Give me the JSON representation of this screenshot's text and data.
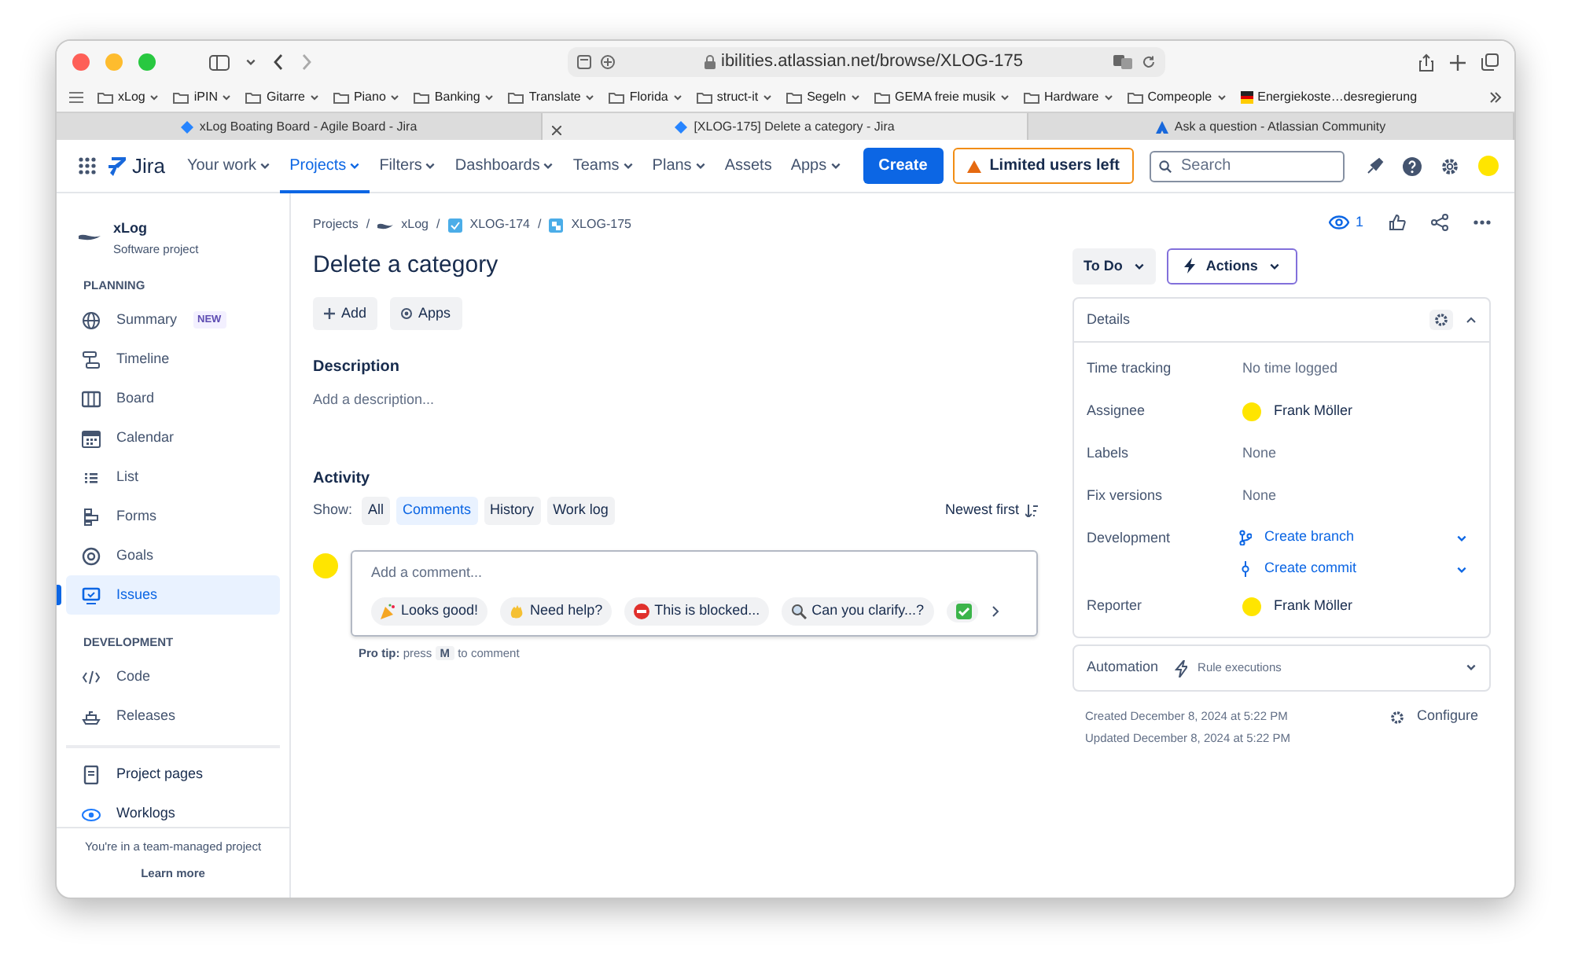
{
  "browser": {
    "url": "ibilities.atlassian.net/browse/XLOG-175",
    "bookmarks": [
      {
        "label": "xLog",
        "kind": "folder"
      },
      {
        "label": "iPIN",
        "kind": "folder"
      },
      {
        "label": "Gitarre",
        "kind": "folder"
      },
      {
        "label": "Piano",
        "kind": "folder"
      },
      {
        "label": "Banking",
        "kind": "folder"
      },
      {
        "label": "Translate",
        "kind": "folder"
      },
      {
        "label": "Florida",
        "kind": "folder"
      },
      {
        "label": "struct-it",
        "kind": "folder"
      },
      {
        "label": "Segeln",
        "kind": "folder"
      },
      {
        "label": "GEMA freie musik",
        "kind": "folder"
      },
      {
        "label": "Hardware",
        "kind": "folder"
      },
      {
        "label": "Compeople",
        "kind": "folder"
      },
      {
        "label": "Energiekoste…desregierung",
        "kind": "site"
      }
    ],
    "tabs": [
      {
        "title": "xLog Boating Board - Agile Board - Jira",
        "selected": false
      },
      {
        "title": "[XLOG-175] Delete a category - Jira",
        "selected": true
      },
      {
        "title": "Ask a question - Atlassian Community",
        "selected": false
      }
    ]
  },
  "topnav": {
    "product": "Jira",
    "menu": [
      {
        "label": "Your work",
        "dropdown": true,
        "selected": false
      },
      {
        "label": "Projects",
        "dropdown": true,
        "selected": true
      },
      {
        "label": "Filters",
        "dropdown": true,
        "selected": false
      },
      {
        "label": "Dashboards",
        "dropdown": true,
        "selected": false
      },
      {
        "label": "Teams",
        "dropdown": true,
        "selected": false
      },
      {
        "label": "Plans",
        "dropdown": true,
        "selected": false
      },
      {
        "label": "Assets",
        "dropdown": false,
        "selected": false
      },
      {
        "label": "Apps",
        "dropdown": true,
        "selected": false
      }
    ],
    "create": "Create",
    "warning": "Limited users left",
    "search": {
      "placeholder": "Search"
    }
  },
  "sidebar": {
    "project": {
      "name": "xLog",
      "type": "Software project"
    },
    "sections": [
      {
        "heading": "PLANNING",
        "items": [
          {
            "label": "Summary",
            "badge": "NEW",
            "selected": false
          },
          {
            "label": "Timeline",
            "selected": false
          },
          {
            "label": "Board",
            "selected": false
          },
          {
            "label": "Calendar",
            "selected": false
          },
          {
            "label": "List",
            "selected": false
          },
          {
            "label": "Forms",
            "selected": false
          },
          {
            "label": "Goals",
            "selected": false
          },
          {
            "label": "Issues",
            "selected": true
          }
        ]
      },
      {
        "heading": "DEVELOPMENT",
        "items": [
          {
            "label": "Code",
            "selected": false
          },
          {
            "label": "Releases",
            "selected": false
          }
        ]
      }
    ],
    "extra": [
      {
        "label": "Project pages"
      },
      {
        "label": "Worklogs"
      }
    ],
    "footer": {
      "note": "You're in a team-managed project",
      "link": "Learn more"
    }
  },
  "issue": {
    "breadcrumbs": [
      "Projects",
      "xLog",
      "XLOG-174",
      "XLOG-175"
    ],
    "breadcrumb_separator": "/",
    "title": "Delete a category",
    "actions": [
      "Add",
      "Apps"
    ],
    "description": {
      "heading": "Description",
      "placeholder": "Add a description..."
    },
    "activity": {
      "heading": "Activity",
      "show": "Show:",
      "filters": [
        {
          "label": "All",
          "selected": false
        },
        {
          "label": "Comments",
          "selected": true
        },
        {
          "label": "History",
          "selected": false
        },
        {
          "label": "Work log",
          "selected": false
        }
      ],
      "sort": "Newest first",
      "comment_placeholder": "Add a comment...",
      "quick_replies": [
        "Looks good!",
        "Need help?",
        "This is blocked...",
        "Can you clarify...?"
      ],
      "tip": {
        "lead": "Pro tip:",
        "before": "press",
        "key": "M",
        "after": "to comment"
      }
    }
  },
  "side": {
    "watchers": "1",
    "status": "To Do",
    "actions": "Actions",
    "details": {
      "heading": "Details",
      "expanded": true,
      "fields": [
        {
          "label": "Time tracking",
          "kind": "text",
          "value": "No time logged"
        },
        {
          "label": "Assignee",
          "kind": "user",
          "value": "Frank Möller"
        },
        {
          "label": "Labels",
          "kind": "text",
          "value": "None"
        },
        {
          "label": "Fix versions",
          "kind": "text",
          "value": "None"
        },
        {
          "label": "Development",
          "kind": "links",
          "links": [
            "Create branch",
            "Create commit"
          ]
        },
        {
          "label": "Reporter",
          "kind": "user",
          "value": "Frank Möller"
        }
      ]
    },
    "automation": {
      "label": "Automation",
      "sub": "Rule executions"
    },
    "created": "Created December 8, 2024 at 5:22 PM",
    "updated": "Updated December 8, 2024 at 5:22 PM",
    "configure": "Configure"
  }
}
